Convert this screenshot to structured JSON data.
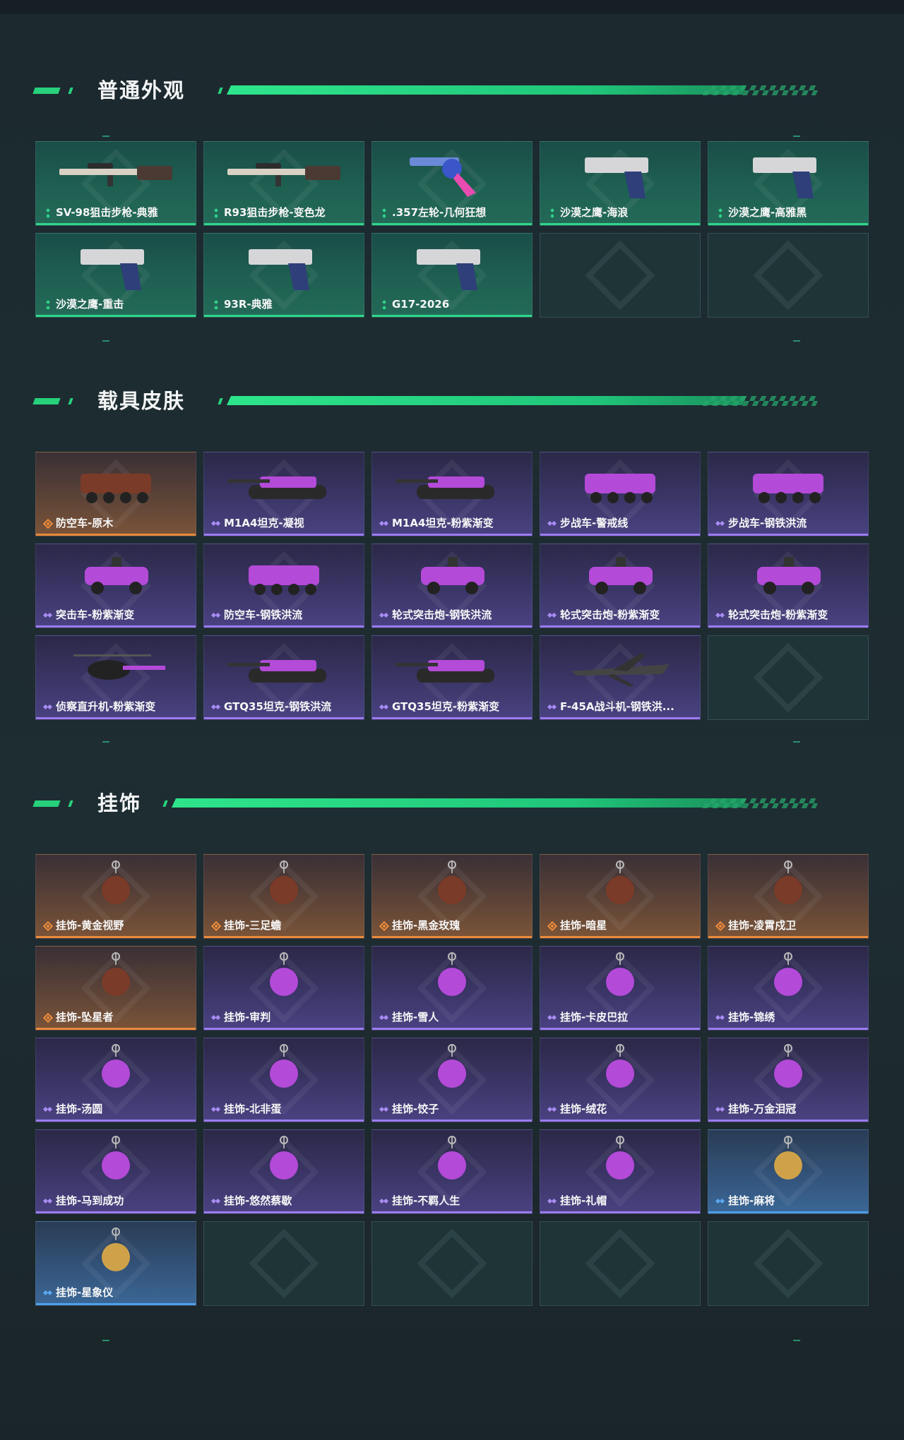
{
  "sections": [
    {
      "title": "普通外观",
      "items": [
        {
          "label": "SV-98狙击步枪-典雅",
          "rarity": "green",
          "icon": "sniper-rifle-icon"
        },
        {
          "label": "R93狙击步枪-变色龙",
          "rarity": "green",
          "icon": "sniper-rifle-icon"
        },
        {
          "label": ".357左轮-几何狂想",
          "rarity": "green",
          "icon": "revolver-icon"
        },
        {
          "label": "沙漠之鹰-海浪",
          "rarity": "green",
          "icon": "pistol-icon"
        },
        {
          "label": "沙漠之鹰-高雅黑",
          "rarity": "green",
          "icon": "pistol-icon"
        },
        {
          "label": "沙漠之鹰-重击",
          "rarity": "green",
          "icon": "pistol-icon"
        },
        {
          "label": "93R-典雅",
          "rarity": "green",
          "icon": "pistol-icon"
        },
        {
          "label": "G17-2026",
          "rarity": "green",
          "icon": "pistol-icon"
        }
      ],
      "empty_slots": 2
    },
    {
      "title": "载具皮肤",
      "items": [
        {
          "label": "防空车-原木",
          "rarity": "orange",
          "icon": "armored-vehicle-icon"
        },
        {
          "label": "M1A4坦克-凝视",
          "rarity": "purple",
          "icon": "tank-icon"
        },
        {
          "label": "M1A4坦克-粉紫渐变",
          "rarity": "purple",
          "icon": "tank-icon"
        },
        {
          "label": "步战车-警戒线",
          "rarity": "purple",
          "icon": "armored-vehicle-icon"
        },
        {
          "label": "步战车-钢铁洪流",
          "rarity": "purple",
          "icon": "armored-vehicle-icon"
        },
        {
          "label": "突击车-粉紫渐变",
          "rarity": "purple",
          "icon": "assault-car-icon"
        },
        {
          "label": "防空车-钢铁洪流",
          "rarity": "purple",
          "icon": "armored-vehicle-icon"
        },
        {
          "label": "轮式突击炮-钢铁洪流",
          "rarity": "purple",
          "icon": "assault-car-icon"
        },
        {
          "label": "轮式突击炮-粉紫渐变",
          "rarity": "purple",
          "icon": "assault-car-icon"
        },
        {
          "label": "轮式突击炮-粉紫渐变",
          "rarity": "purple",
          "icon": "assault-car-icon"
        },
        {
          "label": "侦察直升机-粉紫渐变",
          "rarity": "purple",
          "icon": "helicopter-icon"
        },
        {
          "label": "GTQ35坦克-钢铁洪流",
          "rarity": "purple",
          "icon": "tank-icon"
        },
        {
          "label": "GTQ35坦克-粉紫渐变",
          "rarity": "purple",
          "icon": "tank-icon"
        },
        {
          "label": "F-45A战斗机-钢铁洪...",
          "rarity": "purple",
          "icon": "fighter-jet-icon"
        }
      ],
      "empty_slots": 1
    },
    {
      "title": "挂饰",
      "items": [
        {
          "label": "挂饰-黄金视野",
          "rarity": "orange",
          "icon": "charm-icon"
        },
        {
          "label": "挂饰-三足蟾",
          "rarity": "orange",
          "icon": "charm-icon"
        },
        {
          "label": "挂饰-黑金玫瑰",
          "rarity": "orange",
          "icon": "charm-icon"
        },
        {
          "label": "挂饰-暗星",
          "rarity": "orange",
          "icon": "charm-icon"
        },
        {
          "label": "挂饰-凌霄戍卫",
          "rarity": "orange",
          "icon": "charm-icon"
        },
        {
          "label": "挂饰-坠星者",
          "rarity": "orange",
          "icon": "charm-icon"
        },
        {
          "label": "挂饰-审判",
          "rarity": "purple",
          "icon": "charm-icon"
        },
        {
          "label": "挂饰-雪人",
          "rarity": "purple",
          "icon": "charm-icon"
        },
        {
          "label": "挂饰-卡皮巴拉",
          "rarity": "purple",
          "icon": "charm-icon"
        },
        {
          "label": "挂饰-锦绣",
          "rarity": "purple",
          "icon": "charm-icon"
        },
        {
          "label": "挂饰-汤圆",
          "rarity": "purple",
          "icon": "charm-icon"
        },
        {
          "label": "挂饰-北非蛋",
          "rarity": "purple",
          "icon": "charm-icon"
        },
        {
          "label": "挂饰-饺子",
          "rarity": "purple",
          "icon": "charm-icon"
        },
        {
          "label": "挂饰-绒花",
          "rarity": "purple",
          "icon": "charm-icon"
        },
        {
          "label": "挂饰-万金泪冠",
          "rarity": "purple",
          "icon": "charm-icon"
        },
        {
          "label": "挂饰-马到成功",
          "rarity": "purple",
          "icon": "charm-icon"
        },
        {
          "label": "挂饰-悠然蔡歇",
          "rarity": "purple",
          "icon": "charm-icon"
        },
        {
          "label": "挂饰-不羁人生",
          "rarity": "purple",
          "icon": "charm-icon"
        },
        {
          "label": "挂饰-礼帽",
          "rarity": "purple",
          "icon": "charm-icon"
        },
        {
          "label": "挂饰-麻将",
          "rarity": "blue",
          "icon": "charm-icon"
        },
        {
          "label": "挂饰-星象仪",
          "rarity": "blue",
          "icon": "charm-icon"
        }
      ],
      "empty_slots": 4
    }
  ],
  "colors": {
    "accent": "#27d17c",
    "green_card": "#1e6052",
    "purple_card": "#3b3667",
    "orange_card": "#5c4337",
    "blue_card": "#33537a"
  }
}
